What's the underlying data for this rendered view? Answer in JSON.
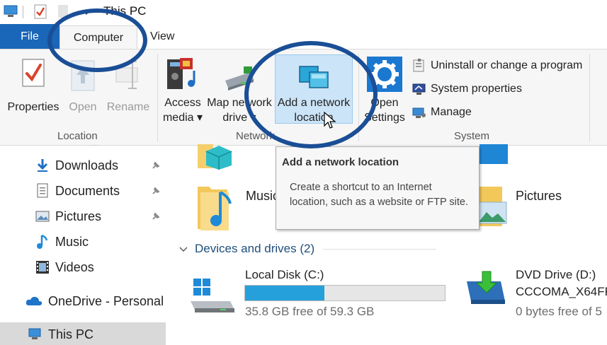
{
  "window": {
    "title": "This PC"
  },
  "tabs": [
    {
      "label": "File"
    },
    {
      "label": "Computer"
    },
    {
      "label": "View"
    }
  ],
  "ribbon": {
    "groups": {
      "location": "Location",
      "network": "Network",
      "system": "System"
    },
    "location_buttons": [
      {
        "label": "Properties",
        "icon": "properties-icon"
      },
      {
        "label": "Open",
        "icon": "open-icon",
        "disabled": true
      },
      {
        "label": "Rename",
        "icon": "rename-icon",
        "disabled": true
      }
    ],
    "network_buttons": [
      {
        "label_line1": "Access",
        "label_line2": "media",
        "icon": "media-icon"
      },
      {
        "label_line1": "Map network",
        "label_line2": "drive",
        "icon": "map-drive-icon"
      },
      {
        "label_line1": "Add a network",
        "label_line2": "location",
        "icon": "network-location-icon"
      }
    ],
    "system_buttons": {
      "open_settings_line1": "Open",
      "open_settings_line2": "Settings",
      "uninstall": "Uninstall or change a program",
      "system_properties": "System properties",
      "manage": "Manage"
    }
  },
  "tooltip": {
    "title": "Add a network location",
    "description": "Create a shortcut to an Internet location, such as a website or FTP site."
  },
  "nav": {
    "items": [
      {
        "label": "Downloads",
        "pinned": true
      },
      {
        "label": "Documents",
        "pinned": true
      },
      {
        "label": "Pictures",
        "pinned": true
      },
      {
        "label": "Music",
        "pinned": false
      },
      {
        "label": "Videos",
        "pinned": false
      },
      {
        "label": "OneDrive - Personal",
        "pinned": false
      },
      {
        "label": "This PC",
        "pinned": false,
        "selected": true
      }
    ]
  },
  "content": {
    "folders": [
      {
        "label": "Music"
      },
      {
        "label": "Pictures"
      }
    ],
    "devices_header": "Devices and drives (2)",
    "drives": [
      {
        "name": "Local Disk (C:)",
        "free": "35.8 GB free of 59.3 GB",
        "used_fraction": 0.396
      },
      {
        "name_line1": "DVD Drive (D:)",
        "name_line2": "CCCOMA_X64FR",
        "free": "0 bytes free of 5"
      }
    ]
  },
  "colors": {
    "accent": "#1a66b8",
    "annotation": "#1a4e96",
    "drive_bar": "#26a0da"
  }
}
